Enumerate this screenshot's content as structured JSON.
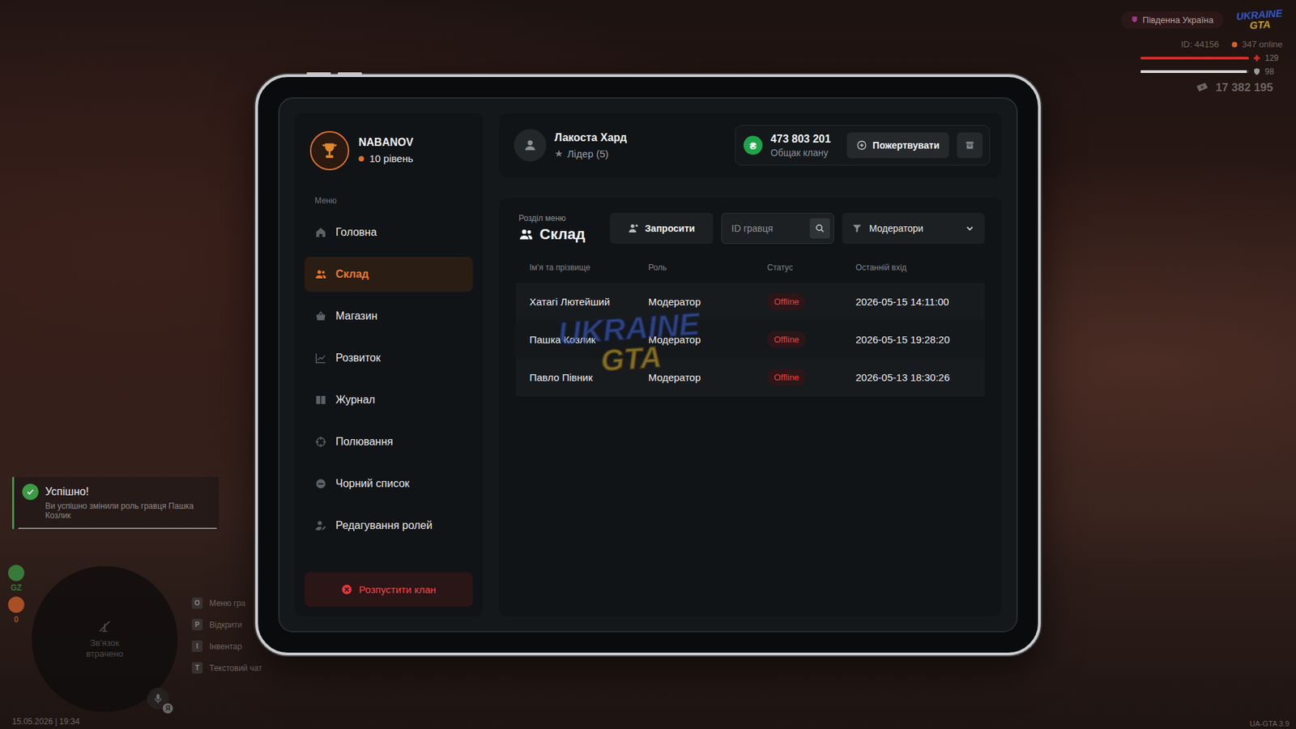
{
  "hud": {
    "server": "Південна Україна",
    "logo": {
      "top": "UKRAINE",
      "bottom": "GTA"
    },
    "player_id": "ID: 44156",
    "online": "347 online",
    "health": {
      "value": "129",
      "level": 1
    },
    "armor": {
      "value": "98",
      "level": 0.98
    },
    "money": "17 382 195",
    "datetime": "15.05.2026 | 19:34",
    "version": "UA-GTA 3.9"
  },
  "notification": {
    "title": "Успішно!",
    "message": "Ви успішно змінили роль гравця Пашка Козлик",
    "timer_level": 0.97
  },
  "minimap": {
    "status": "Зв'язок втрачено"
  },
  "side_indicators": [
    {
      "label": "GZ",
      "color": "#3c9a45"
    },
    {
      "label": "0",
      "color": "#d4622a"
    }
  ],
  "voice": {
    "badge": "Я"
  },
  "keybinds": [
    {
      "key": "O",
      "label": "Меню гра"
    },
    {
      "key": "P",
      "label": "Відкрити"
    },
    {
      "key": "I",
      "label": "Інвентар"
    },
    {
      "key": "T",
      "label": "Текстовий чат"
    }
  ],
  "tablet": {
    "profile": {
      "name": "NABANOV",
      "level": "10 рівень"
    },
    "menu_label": "Меню",
    "menu": [
      {
        "label": "Головна",
        "selected": false
      },
      {
        "label": "Склад",
        "selected": true
      },
      {
        "label": "Магазин",
        "selected": false
      },
      {
        "label": "Розвиток",
        "selected": false
      },
      {
        "label": "Журнал",
        "selected": false
      },
      {
        "label": "Полювання",
        "selected": false
      },
      {
        "label": "Чорний список",
        "selected": false
      },
      {
        "label": "Редагування ролей",
        "selected": false
      }
    ],
    "disband_button": "Розпустити клан",
    "leader": {
      "name": "Лакоста Хард",
      "role": "Лідер (5)"
    },
    "treasury": {
      "currency_icon": "₴",
      "amount": "473 803 201",
      "label": "Общак клану"
    },
    "donate_button": "Пожертвувати",
    "section": {
      "caption": "Розділ меню",
      "title": "Склад"
    },
    "invite_button": "Запросити",
    "search": {
      "placeholder": "ID гравця"
    },
    "filter": {
      "value": "Модератори"
    },
    "table": {
      "columns": [
        "Ім'я та прізвище",
        "Роль",
        "Статус",
        "Останній вхід"
      ],
      "rows": [
        {
          "name": "Хатагі Лютейший",
          "role": "Модератор",
          "status": "Offline",
          "last_login": "2026-05-15 14:11:00"
        },
        {
          "name": "Пашка Козлик",
          "role": "Модератор",
          "status": "Offline",
          "last_login": "2026-05-15 19:28:20"
        },
        {
          "name": "Павло Півник",
          "role": "Модератор",
          "status": "Offline",
          "last_login": "2026-05-13 18:30:26"
        }
      ]
    },
    "watermark": {
      "top": "UKRAINE",
      "bottom": "GTA"
    }
  }
}
